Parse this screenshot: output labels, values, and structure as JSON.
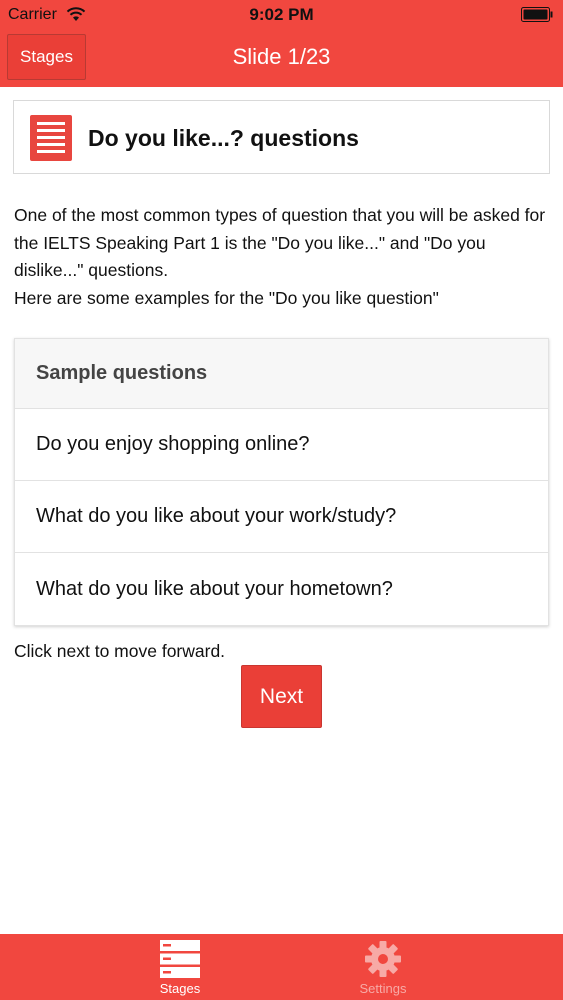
{
  "status_bar": {
    "carrier": "Carrier",
    "time": "9:02 PM"
  },
  "nav": {
    "left_button": "Stages",
    "title": "Slide 1/23"
  },
  "title_card": {
    "icon": "document-list-icon",
    "title": "Do you like...? questions"
  },
  "intro": {
    "line1": "One of the most common types of question that you will be asked for the IELTS Speaking Part 1 is the \"Do you like...\" and \"Do you dislike...\" questions.",
    "line2": "Here are some examples for the \"Do you like question\""
  },
  "sample_list": {
    "header": "Sample questions",
    "items": [
      "Do you enjoy shopping online?",
      "What do you like about your work/study?",
      "What do you like about your hometown?"
    ]
  },
  "hint": "Click next to move forward.",
  "next_button": "Next",
  "tabbar": {
    "tabs": [
      {
        "label": "Stages",
        "icon": "stages-list-icon",
        "active": true
      },
      {
        "label": "Settings",
        "icon": "gear-icon",
        "active": false
      }
    ]
  },
  "colors": {
    "primary": "#f1473f",
    "button": "#ea3f37",
    "inactive_tab": "#f7aaa6"
  }
}
